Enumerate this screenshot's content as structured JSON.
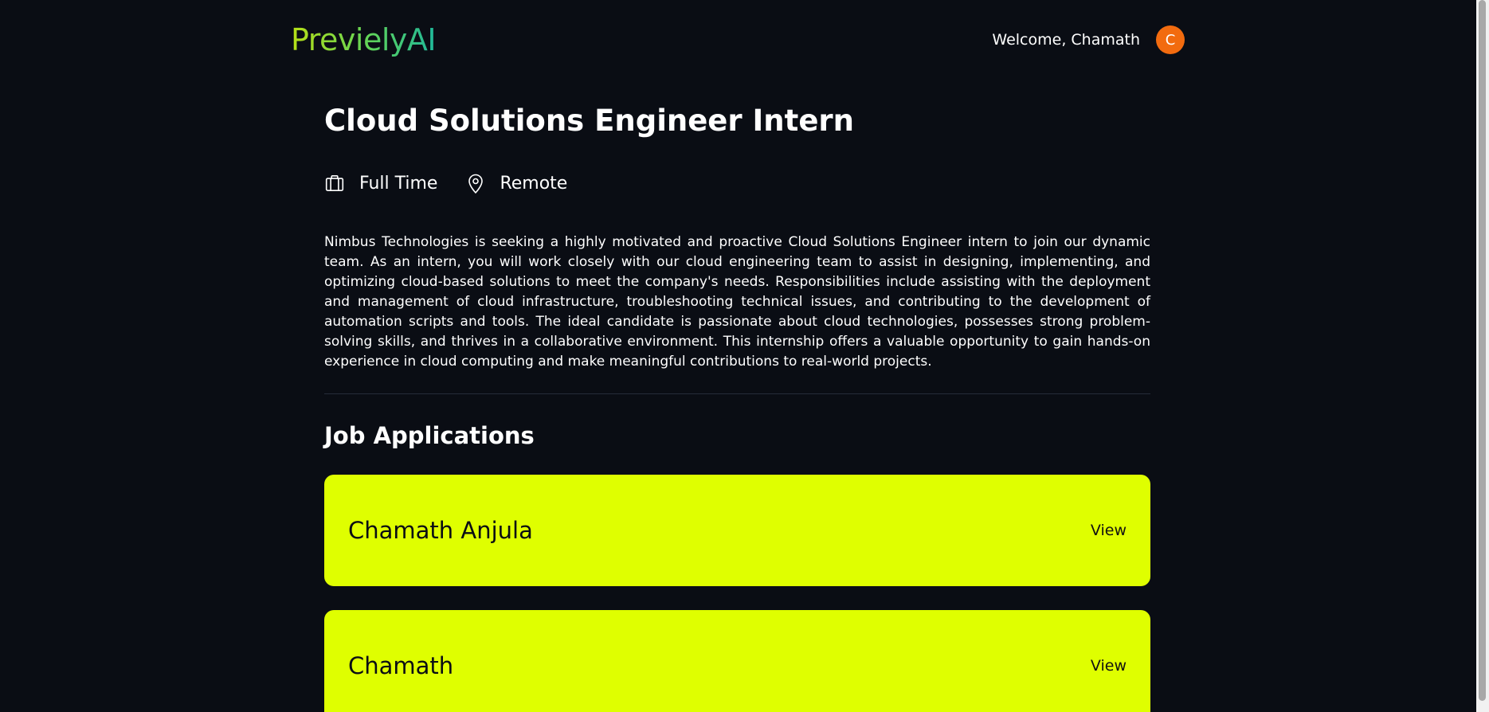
{
  "header": {
    "logo": "PrevielyAI",
    "welcome": "Welcome, Chamath",
    "avatar_initial": "C",
    "avatar_color": "#f26b0f"
  },
  "job": {
    "title": "Cloud Solutions Engineer Intern",
    "type": "Full Time",
    "type_icon": "briefcase-icon",
    "location": "Remote",
    "location_icon": "map-pin-icon",
    "description": "Nimbus Technologies is seeking a highly motivated and proactive Cloud Solutions Engineer intern to join our dynamic team. As an intern, you will work closely with our cloud engineering team to assist in designing, implementing, and optimizing cloud-based solutions to meet the company's needs. Responsibilities include assisting with the deployment and management of cloud infrastructure, troubleshooting technical issues, and contributing to the development of automation scripts and tools. The ideal candidate is passionate about cloud technologies, possesses strong problem-solving skills, and thrives in a collaborative environment. This internship offers a valuable opportunity to gain hands-on experience in cloud computing and make meaningful contributions to real-world projects."
  },
  "applications": {
    "heading": "Job Applications",
    "card_color": "#dfff00",
    "items": [
      {
        "name": "Chamath Anjula",
        "action": "View"
      },
      {
        "name": "Chamath",
        "action": "View"
      }
    ]
  }
}
